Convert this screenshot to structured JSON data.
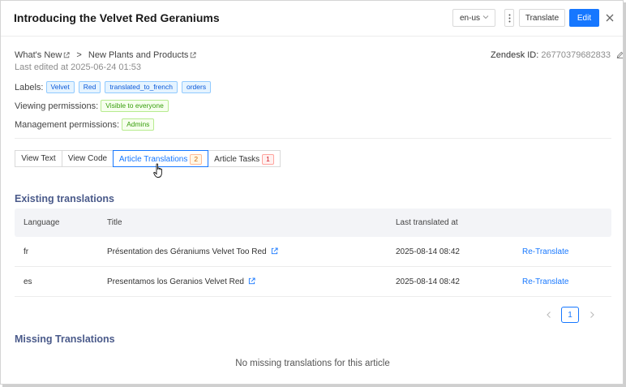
{
  "header": {
    "title": "Introducing the Velvet Red Geraniums",
    "language_value": "en-us",
    "translate_label": "Translate",
    "edit_label": "Edit"
  },
  "breadcrumb": {
    "items": [
      "What's New",
      "New Plants and Products"
    ],
    "separator": ">"
  },
  "last_edited": "Last edited at 2025-06-24 01:53",
  "zendesk": {
    "label": "Zendesk ID:",
    "id": "26770379682833"
  },
  "labels": {
    "label": "Labels:",
    "tags": [
      "Velvet",
      "Red",
      "translated_to_french",
      "orders"
    ]
  },
  "viewing_permissions": {
    "label": "Viewing permissions:",
    "value": "Visible to everyone"
  },
  "management_permissions": {
    "label": "Management permissions:",
    "value": "Admins"
  },
  "tabs": [
    {
      "label": "View Text"
    },
    {
      "label": "View Code"
    },
    {
      "label": "Article Translations",
      "count": "2"
    },
    {
      "label": "Article Tasks",
      "count": "1"
    }
  ],
  "existing_translations": {
    "title": "Existing translations",
    "columns": [
      "Language",
      "Title",
      "Last translated at"
    ],
    "rows": [
      {
        "language": "fr",
        "title": "Présentation des Géraniums Velvet Too Red",
        "last_translated": "2025-08-14 08:42",
        "action": "Re-Translate"
      },
      {
        "language": "es",
        "title": "Presentamos los Geranios Velvet Red",
        "last_translated": "2025-08-14 08:42",
        "action": "Re-Translate"
      }
    ]
  },
  "pagination": {
    "current_page": "1"
  },
  "missing_translations": {
    "title": "Missing Translations",
    "empty_message": "No missing translations for this article"
  },
  "colors": {
    "primary": "#1677ff",
    "section_title": "#4a5a8a",
    "tag_blue_bg": "#e6f4ff",
    "tag_green_bg": "#f6ffed"
  },
  "icons": {
    "external_link": "external-link-icon",
    "edit": "pencil-icon",
    "close": "close-icon",
    "more": "vertical-dots-icon",
    "dropdown": "chevron-down-icon",
    "cursor": "hand-pointer-icon"
  }
}
